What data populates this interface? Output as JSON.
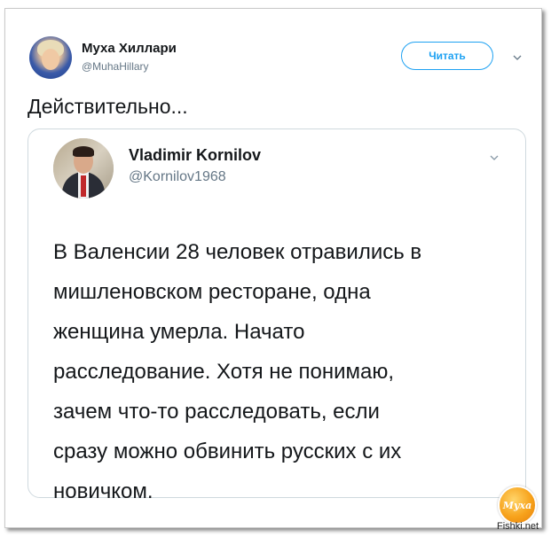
{
  "tweet": {
    "author_name": "Муха Хиллари",
    "author_handle": "@MuhaHillary",
    "follow_label": "Читать",
    "text": "Действительно..."
  },
  "quoted_tweet": {
    "author_name": "Vladimir Kornilov",
    "author_handle": "@Kornilov1968",
    "text": "В Валенсии 28 человек отравились в\nмишленовском ресторане, одна\nженщина умерла. Начато\nрасследование. Хотя не понимаю,\nзачем что-то расследовать, если\nсразу можно обвинить русских с их\nновичком."
  },
  "watermark": {
    "logo_text": "Муха",
    "site": "Fishki.net"
  },
  "colors": {
    "accent": "#1da1f2",
    "secondary_text": "#657786",
    "primary_text": "#14171a"
  },
  "icons": {
    "more_menu": "chevron-down-icon",
    "quote_more_menu": "chevron-down-icon"
  }
}
